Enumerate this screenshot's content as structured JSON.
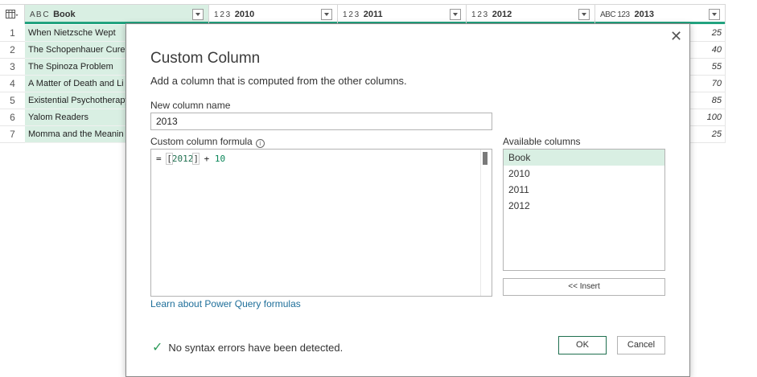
{
  "grid": {
    "columns": [
      {
        "type_icon": "A B C",
        "label": "Book"
      },
      {
        "type_icon": "1 2 3",
        "label": "2010"
      },
      {
        "type_icon": "1 2 3",
        "label": "2011"
      },
      {
        "type_icon": "1 2 3",
        "label": "2012"
      },
      {
        "type_icon": "ABC 123",
        "label": "2013"
      }
    ],
    "rows": [
      {
        "n": "1",
        "book": "When Nietzsche Wept",
        "v2013": "25"
      },
      {
        "n": "2",
        "book": "The Schopenhauer Cure",
        "v2013": "40"
      },
      {
        "n": "3",
        "book": "The Spinoza Problem",
        "v2013": "55"
      },
      {
        "n": "4",
        "book": "A Matter of Death and Li",
        "v2013": "70"
      },
      {
        "n": "5",
        "book": "Existential Psychotherapy",
        "v2013": "85"
      },
      {
        "n": "6",
        "book": "Yalom Readers",
        "v2013": "100"
      },
      {
        "n": "7",
        "book": "Momma and the Meanin",
        "v2013": "25"
      }
    ]
  },
  "dialog": {
    "close": "✕",
    "title": "Custom Column",
    "subtitle": "Add a column that is computed from the other columns.",
    "name_label": "New column name",
    "name_value": "2013",
    "formula_label": "Custom column formula",
    "formula": {
      "prefix": "= ",
      "bracket_open": "[",
      "ref": "2012",
      "bracket_close": "]",
      "op": " + ",
      "num": "10"
    },
    "available_label": "Available columns",
    "available": [
      {
        "label": "Book",
        "selected": true
      },
      {
        "label": "2010",
        "selected": false
      },
      {
        "label": "2011",
        "selected": false
      },
      {
        "label": "2012",
        "selected": false
      }
    ],
    "insert_label": "<< Insert",
    "learn_link": "Learn about Power Query formulas",
    "status": "No syntax errors have been detected.",
    "ok_label": "OK",
    "cancel_label": "Cancel"
  },
  "colors": {
    "accent": "#22a37f",
    "selected": "#d9efe3",
    "link": "#1f6f9a",
    "check": "#2d9b5a"
  }
}
